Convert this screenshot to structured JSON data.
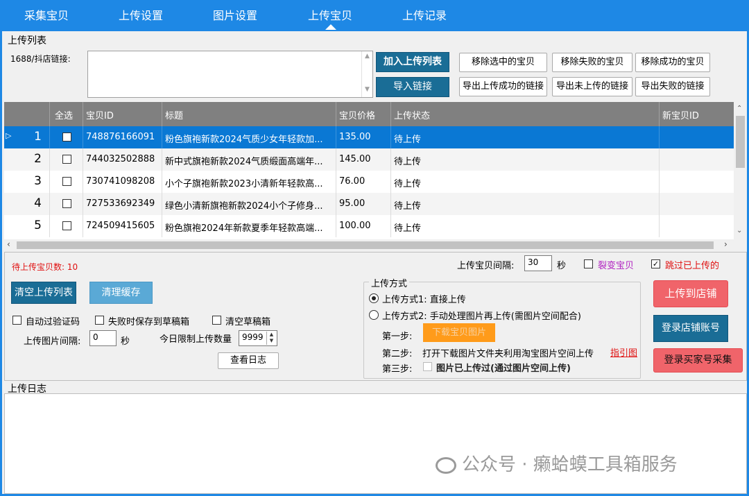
{
  "nav": {
    "tabs": [
      "采集宝贝",
      "上传设置",
      "图片设置",
      "上传宝贝",
      "上传记录"
    ],
    "active_index": 3
  },
  "upload_list": {
    "section_title": "上传列表",
    "link_label": "1688/抖店链接:",
    "buttons": {
      "add": "加入上传列表",
      "import": "导入链接",
      "remove_selected": "移除选中的宝贝",
      "remove_failed": "移除失败的宝贝",
      "remove_success": "移除成功的宝贝",
      "export_success": "导出上传成功的链接",
      "export_not_uploaded": "导出未上传的链接",
      "export_failed": "导出失败的链接"
    }
  },
  "table": {
    "columns": [
      "全选",
      "宝贝ID",
      "标题",
      "宝贝价格",
      "上传状态",
      "新宝贝ID"
    ],
    "rows": [
      {
        "n": "1",
        "id": "748876166091",
        "title": "粉色旗袍新款2024气质少女年轻款加...",
        "price": "135.00",
        "status": "待上传",
        "new_id": ""
      },
      {
        "n": "2",
        "id": "744032502888",
        "title": "新中式旗袍新款2024气质缎面高端年...",
        "price": "145.00",
        "status": "待上传",
        "new_id": ""
      },
      {
        "n": "3",
        "id": "730741098208",
        "title": "小个子旗袍新款2023小清新年轻款高...",
        "price": "76.00",
        "status": "待上传",
        "new_id": ""
      },
      {
        "n": "4",
        "id": "727533692349",
        "title": "绿色小清新旗袍新款2024小个子修身...",
        "price": "95.00",
        "status": "待上传",
        "new_id": ""
      },
      {
        "n": "5",
        "id": "724509415605",
        "title": "粉色旗袍2024年新款夏季年轻款高端...",
        "price": "100.00",
        "status": "待上传",
        "new_id": ""
      }
    ],
    "selected_row": 0
  },
  "settings": {
    "pending_label": "待上传宝贝数: 10",
    "interval_label": "上传宝贝间隔:",
    "interval_value": "30",
    "seconds": "秒",
    "fission_label": "裂变宝贝",
    "skip_label": "跳过已上传的",
    "clear_list": "清空上传列表",
    "clear_cache": "清理缓存",
    "auto_captcha": "自动过验证码",
    "save_draft_on_fail": "失败时保存到草稿箱",
    "clear_draft": "清空草稿箱",
    "img_interval_label": "上传图片间隔:",
    "img_interval_value": "0",
    "daily_limit_label": "今日限制上传数量",
    "daily_limit_value": "9999",
    "view_log": "查看日志"
  },
  "upload_mode": {
    "title": "上传方式",
    "mode1": "上传方式1: 直接上传",
    "mode2": "上传方式2: 手动处理图片再上传(需图片空间配合)",
    "step1_label": "第一步:",
    "step1_button": "下载宝贝图片",
    "step2_label": "第二步:",
    "step2_text": "打开下载图片文件夹利用淘宝图片空间上传",
    "guide_link": "指引图",
    "step3_label": "第三步:",
    "step3_text": "图片已上传过(通过图片空间上传)"
  },
  "actions": {
    "upload_store": "上传到店铺",
    "login_store": "登录店铺账号",
    "login_buyer": "登录买家号采集"
  },
  "log": {
    "title": "上传日志"
  },
  "watermark": "公众号 · 癞蛤蟆工具箱服务",
  "colors": {
    "primary": "#1e88e5",
    "selected_row": "#0a78d4",
    "action_red": "#f0646a",
    "action_blue": "#1a6d96",
    "step_orange": "#ff9b1a"
  }
}
